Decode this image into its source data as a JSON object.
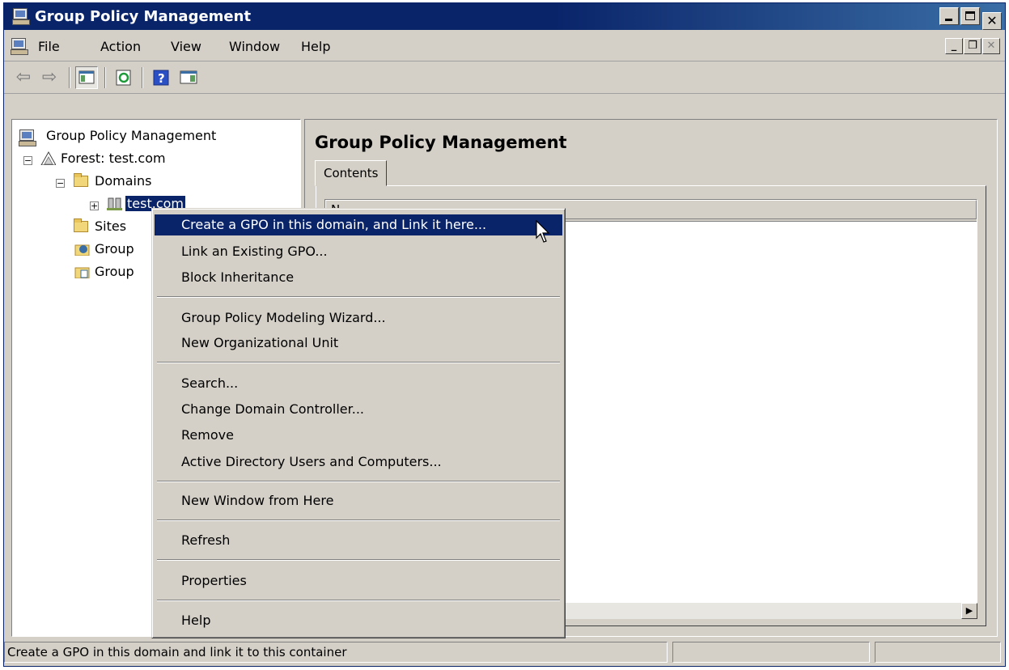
{
  "window": {
    "title": "Group Policy Management",
    "caption_buttons": [
      "minimize",
      "maximize",
      "close"
    ]
  },
  "menubar": {
    "items": [
      "File",
      "Action",
      "View",
      "Window",
      "Help"
    ]
  },
  "toolbar": {
    "buttons": [
      "back-icon",
      "forward-icon",
      "show-hide-tree-icon",
      "refresh-icon",
      "help-icon",
      "show-hide-action-pane-icon"
    ]
  },
  "tree": {
    "root": "Group Policy Management",
    "forest": "Forest: test.com",
    "domains": "Domains",
    "domain": "test.com",
    "sites": "Sites",
    "item5": "Group",
    "item6": "Group"
  },
  "right_pane": {
    "title": "Group Policy Management",
    "tab": "Contents",
    "column_header": "N"
  },
  "context_menu": {
    "items": [
      "Create a GPO in this domain, and Link it here...",
      "Link an Existing GPO...",
      "Block Inheritance",
      "Group Policy Modeling Wizard...",
      "New Organizational Unit",
      "Search...",
      "Change Domain Controller...",
      "Remove",
      "Active Directory Users and Computers...",
      "New Window from Here",
      "Refresh",
      "Properties",
      "Help"
    ],
    "highlighted_index": 0
  },
  "statusbar": {
    "text": "Create a GPO in this domain and link it to this container"
  },
  "colors": {
    "title_active": "#0a246a",
    "selection": "#0a246a",
    "face": "#d4d0c8"
  }
}
